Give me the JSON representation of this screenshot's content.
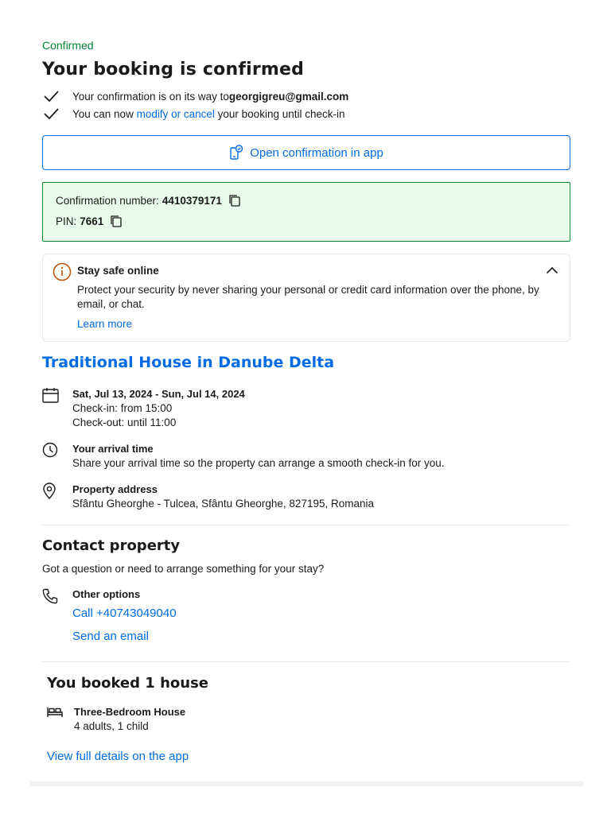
{
  "header": {
    "status": "Confirmed",
    "title": "Your booking is confirmed",
    "line1_prefix": "Your confirmation is on its way to ",
    "line1_email": "georgigreu@gmail.com",
    "line2_prefix": "You can now ",
    "line2_link": "modify or cancel",
    "line2_suffix": " your booking until check-in"
  },
  "app_button": {
    "label": "Open confirmation in app"
  },
  "confirmation": {
    "number_label": "Confirmation number:",
    "number_value": "4410379171",
    "pin_label": "PIN:",
    "pin_value": "7661"
  },
  "safety": {
    "title": "Stay safe online",
    "text": "Protect your security by never sharing your personal or credit card information over the phone, by email, or chat.",
    "link": "Learn more"
  },
  "property": {
    "name": "Traditional House in Danube Delta",
    "dates": "Sat, Jul 13, 2024 - Sun, Jul 14, 2024",
    "checkin": "Check-in: from 15:00",
    "checkout": "Check-out: until 11:00",
    "arrival_title": "Your arrival time",
    "arrival_text": "Share your arrival time so the property can arrange a smooth check-in for you.",
    "address_title": "Property address",
    "address": "Sfântu Gheorghe - Tulcea, Sfântu Gheorghe, 827195, Romania"
  },
  "contact": {
    "title": "Contact property",
    "subtitle": "Got a question or need to arrange something for your stay?",
    "options_title": "Other options",
    "call": "Call +40743049040",
    "email": "Send an email"
  },
  "booking": {
    "title": "You booked 1 house",
    "room_name": "Three-Bedroom House",
    "guests": "4 adults, 1 child",
    "details_link": "View full details on the app"
  },
  "colors": {
    "accent": "#006ce4",
    "success": "#008234",
    "success_bg": "#e7fde9",
    "warning_icon": "#c24e00"
  }
}
